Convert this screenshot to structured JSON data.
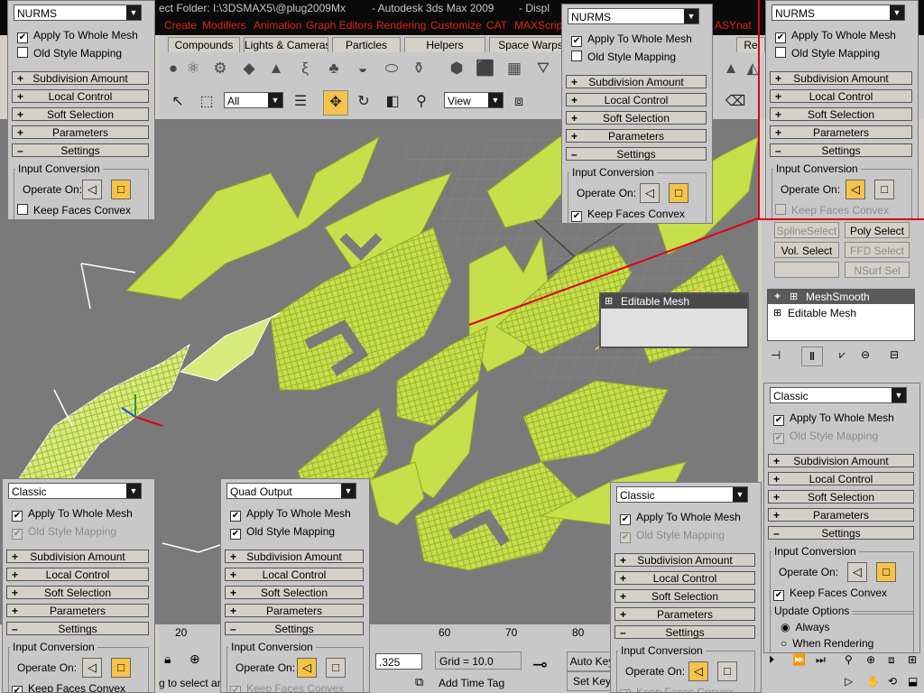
{
  "title": {
    "left": "ect Folder: I:\\3DSMAX5\\@plug2009Mx",
    "app": "- Autodesk 3ds Max  2009",
    "right": "- Displ"
  },
  "menu": [
    "Create",
    "Modifiers",
    "Animation",
    "Graph Editors",
    "Rendering",
    "Customize",
    "CAT",
    "MAXScript",
    "ASYnat"
  ],
  "command_tabs": [
    "Compounds",
    "Lights & Cameras",
    "Particles",
    "Helpers",
    "Space Warps",
    "Re"
  ],
  "toolbar": {
    "selection_filter": "All",
    "ref_coord": "View"
  },
  "status": {
    "ruler_ticks": [
      "20",
      "60",
      "70",
      "80"
    ],
    "prompt": "g to select an",
    "coord_value": ".325",
    "grid": "Grid = 10.0",
    "auto_key": "Auto Key",
    "set_key": "Set Key",
    "add_time_tag": "Add Time Tag"
  },
  "right_panel": {
    "spline_select": "SplineSelect",
    "poly_select": "Poly Select",
    "vol_select": "Vol. Select",
    "ffd_select": "FFD Select",
    "nsurf_sel": "NSurf Sel",
    "stack": [
      "MeshSmooth",
      "Editable Mesh"
    ]
  },
  "callout": {
    "stack_item": "Editable Mesh"
  },
  "panels": [
    {
      "type": "NURMS",
      "apply": "Apply To Whole Mesh",
      "apply_checked": true,
      "old": "Old Style Mapping",
      "old_checked": false,
      "old_disabled": false,
      "rollouts": [
        "Subdivision Amount",
        "Local Control",
        "Soft Selection",
        "Parameters",
        "Settings"
      ],
      "group": "Input Conversion",
      "operate": "Operate On:",
      "active": "poly",
      "keep": "Keep Faces Convex",
      "keep_checked": false,
      "keep_disabled": false
    },
    {
      "type": "NURMS",
      "apply": "Apply To Whole Mesh",
      "apply_checked": true,
      "old": "Old Style Mapping",
      "old_checked": false,
      "old_disabled": false,
      "rollouts": [
        "Subdivision Amount",
        "Local Control",
        "Soft Selection",
        "Parameters",
        "Settings"
      ],
      "group": "Input Conversion",
      "operate": "Operate On:",
      "active": "poly",
      "keep": "Keep Faces Convex",
      "keep_checked": true,
      "keep_disabled": false
    },
    {
      "type": "NURMS",
      "apply": "Apply To Whole Mesh",
      "apply_checked": true,
      "old": "Old Style Mapping",
      "old_checked": false,
      "old_disabled": false,
      "rollouts": [
        "Subdivision Amount",
        "Local Control",
        "Soft Selection",
        "Parameters",
        "Settings"
      ],
      "group": "Input Conversion",
      "operate": "Operate On:",
      "active": "tri",
      "keep": "Keep Faces Convex",
      "keep_checked": false,
      "keep_disabled": true
    },
    {
      "type": "Classic",
      "apply": "Apply To Whole Mesh",
      "apply_checked": true,
      "old": "Old Style Mapping",
      "old_checked": true,
      "old_disabled": true,
      "rollouts": [
        "Subdivision Amount",
        "Local Control",
        "Soft Selection",
        "Parameters",
        "Settings"
      ],
      "group": "Input Conversion",
      "operate": "Operate On:",
      "active": "poly",
      "keep": "Keep Faces Convex",
      "keep_checked": true,
      "keep_disabled": false,
      "update_group": "Update Options",
      "always": "Always",
      "when_rendering": "When Rendering"
    },
    {
      "type": "Classic",
      "apply": "Apply To Whole Mesh",
      "apply_checked": true,
      "old": "Old Style Mapping",
      "old_checked": true,
      "old_disabled": true,
      "rollouts": [
        "Subdivision Amount",
        "Local Control",
        "Soft Selection",
        "Parameters",
        "Settings"
      ],
      "group": "Input Conversion",
      "operate": "Operate On:",
      "active": "poly",
      "keep": "Keep Faces Convex",
      "keep_checked": true,
      "keep_disabled": false
    },
    {
      "type": "Quad Output",
      "apply": "Apply To Whole Mesh",
      "apply_checked": true,
      "old": "Old Style Mapping",
      "old_checked": true,
      "old_disabled": false,
      "rollouts": [
        "Subdivision Amount",
        "Local Control",
        "Soft Selection",
        "Parameters",
        "Settings"
      ],
      "group": "Input Conversion",
      "operate": "Operate On:",
      "active": "tri",
      "keep": "Keep Faces Convex",
      "keep_checked": true,
      "keep_disabled": true
    },
    {
      "type": "Classic",
      "apply": "Apply To Whole Mesh",
      "apply_checked": true,
      "old": "Old Style Mapping",
      "old_checked": true,
      "old_disabled": true,
      "rollouts": [
        "Subdivision Amount",
        "Local Control",
        "Soft Selection",
        "Parameters",
        "Settings"
      ],
      "group": "Input Conversion",
      "operate": "Operate On:",
      "active": "tri",
      "keep": "Keep Faces Convex",
      "keep_checked": true,
      "keep_disabled": true
    }
  ],
  "colors": {
    "mesh": "#c5e04a",
    "mesh_wire": "#93a82a",
    "highlight": "#f6c34a",
    "callout": "#e0001a",
    "viewport": "#7a7a7a"
  }
}
